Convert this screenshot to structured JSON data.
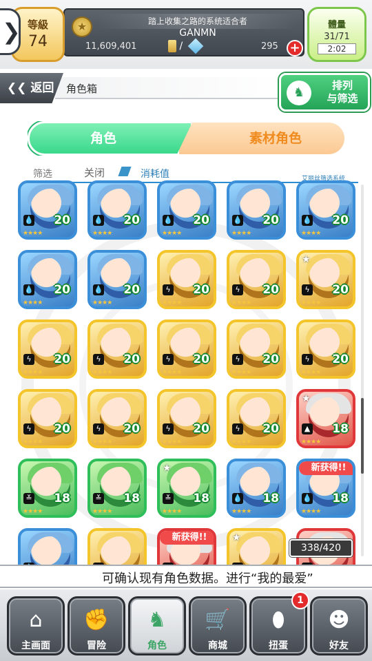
{
  "header": {
    "level_label": "等級",
    "level_value": "74",
    "title": "踏上收集之路的系统适合者",
    "player_name": "GANMN",
    "gold": "11,609,401",
    "currency_separator": "/",
    "stones": "295",
    "plus": "+",
    "energy_label": "體量",
    "energy_value": "31/71",
    "energy_timer": "2:02",
    "back_arrow": "❯"
  },
  "navbar": {
    "back_label": "❮❮ 返回",
    "title": "角色箱",
    "sort_label_1": "排列",
    "sort_label_2": "与筛选",
    "sort_icon": "rabbit-icon"
  },
  "tabs": {
    "character": "角色",
    "material": "素材角色"
  },
  "filter": {
    "label": "筛选",
    "status": "关闭",
    "sort_key": "消耗值",
    "system_label": "艾丽丝筛选系统"
  },
  "grid": {
    "tiles": [
      {
        "color": "blue",
        "element": "water",
        "cost": "20",
        "stars": "★★★★"
      },
      {
        "color": "blue",
        "element": "water",
        "cost": "20",
        "stars": "★★★★"
      },
      {
        "color": "blue",
        "element": "water",
        "cost": "20",
        "stars": "★★★★"
      },
      {
        "color": "blue",
        "element": "water",
        "cost": "20",
        "stars": "★★★★"
      },
      {
        "color": "blue",
        "element": "water",
        "cost": "20",
        "stars": "★★★★"
      },
      {
        "color": "blue",
        "element": "water",
        "cost": "20",
        "stars": "★★★★"
      },
      {
        "color": "blue",
        "element": "water",
        "cost": "20",
        "stars": "★★★★"
      },
      {
        "color": "yellow",
        "element": "thunder",
        "cost": "20",
        "stars": "★★★★"
      },
      {
        "color": "yellow",
        "element": "thunder",
        "cost": "20",
        "stars": "★★★★"
      },
      {
        "color": "yellow",
        "element": "thunder",
        "cost": "20",
        "stars": "★★★★",
        "star_badge": true
      },
      {
        "color": "yellow",
        "element": "thunder",
        "cost": "20",
        "stars": "★★★★"
      },
      {
        "color": "yellow",
        "element": "thunder",
        "cost": "20",
        "stars": "★★★★"
      },
      {
        "color": "yellow",
        "element": "thunder",
        "cost": "20",
        "stars": "★★★★"
      },
      {
        "color": "yellow",
        "element": "thunder",
        "cost": "20",
        "stars": "★★★★"
      },
      {
        "color": "yellow",
        "element": "thunder",
        "cost": "20",
        "stars": "★★★★"
      },
      {
        "color": "yellow",
        "element": "thunder",
        "cost": "20",
        "stars": "★★★★"
      },
      {
        "color": "yellow",
        "element": "thunder",
        "cost": "20",
        "stars": "★★★★"
      },
      {
        "color": "yellow",
        "element": "thunder",
        "cost": "20",
        "stars": "★★★★"
      },
      {
        "color": "yellow",
        "element": "thunder",
        "cost": "20",
        "stars": "★★★★"
      },
      {
        "color": "red",
        "element": "fire",
        "cost": "18",
        "stars": "★★★★",
        "star_badge": true
      },
      {
        "color": "green",
        "element": "wind",
        "cost": "18",
        "stars": "★★★★"
      },
      {
        "color": "green",
        "element": "wind",
        "cost": "18",
        "stars": "★★★★"
      },
      {
        "color": "green",
        "element": "wind",
        "cost": "18",
        "stars": "★★★★",
        "star_badge": true
      },
      {
        "color": "blue",
        "element": "water",
        "cost": "18",
        "stars": "★★★★"
      },
      {
        "color": "blue",
        "element": "water",
        "cost": "18",
        "stars": "★★★★",
        "new": "新获得!!"
      },
      {
        "color": "blue",
        "element": "water",
        "cost": "",
        "stars": ""
      },
      {
        "color": "yellow",
        "element": "thunder",
        "cost": "",
        "stars": ""
      },
      {
        "color": "red",
        "element": "fire",
        "cost": "",
        "stars": "",
        "new": "新获得!!"
      },
      {
        "color": "yellow",
        "element": "thunder",
        "cost": "",
        "stars": "",
        "star_badge": true
      },
      {
        "color": "red",
        "element": "fire",
        "cost": "",
        "stars": ""
      }
    ],
    "element_glyphs": {
      "water": "💧",
      "thunder": "ϟ",
      "fire": "▲",
      "wind": "≚"
    }
  },
  "inventory": {
    "count": "338/420"
  },
  "message": {
    "text": "可确认现有角色数据。进行“我的最爱”"
  },
  "bottom_nav": [
    {
      "name": "nav-home",
      "label": "主画面",
      "icon": "⌂",
      "icon_name": "home-icon",
      "active": false
    },
    {
      "name": "nav-adventure",
      "label": "冒险",
      "icon": "✊",
      "icon_name": "fist-icon",
      "active": false
    },
    {
      "name": "nav-character",
      "label": "角色",
      "icon": "♞",
      "icon_name": "rabbit-icon",
      "active": true
    },
    {
      "name": "nav-shop",
      "label": "商城",
      "icon": "🛒",
      "icon_name": "cart-icon",
      "active": false
    },
    {
      "name": "nav-gacha",
      "label": "扭蛋",
      "icon": "⬮",
      "icon_name": "egg-icon",
      "active": false,
      "badge": "1"
    },
    {
      "name": "nav-friends",
      "label": "好友",
      "icon": "☻",
      "icon_name": "friends-icon",
      "active": false
    }
  ],
  "colors": {
    "accent_green": "#39d88b",
    "accent_orange": "#f08b1f",
    "tile_blue": "#3b8fd9",
    "tile_yellow": "#f4c52a",
    "tile_green": "#2fbf5a",
    "tile_red": "#e0373a"
  }
}
